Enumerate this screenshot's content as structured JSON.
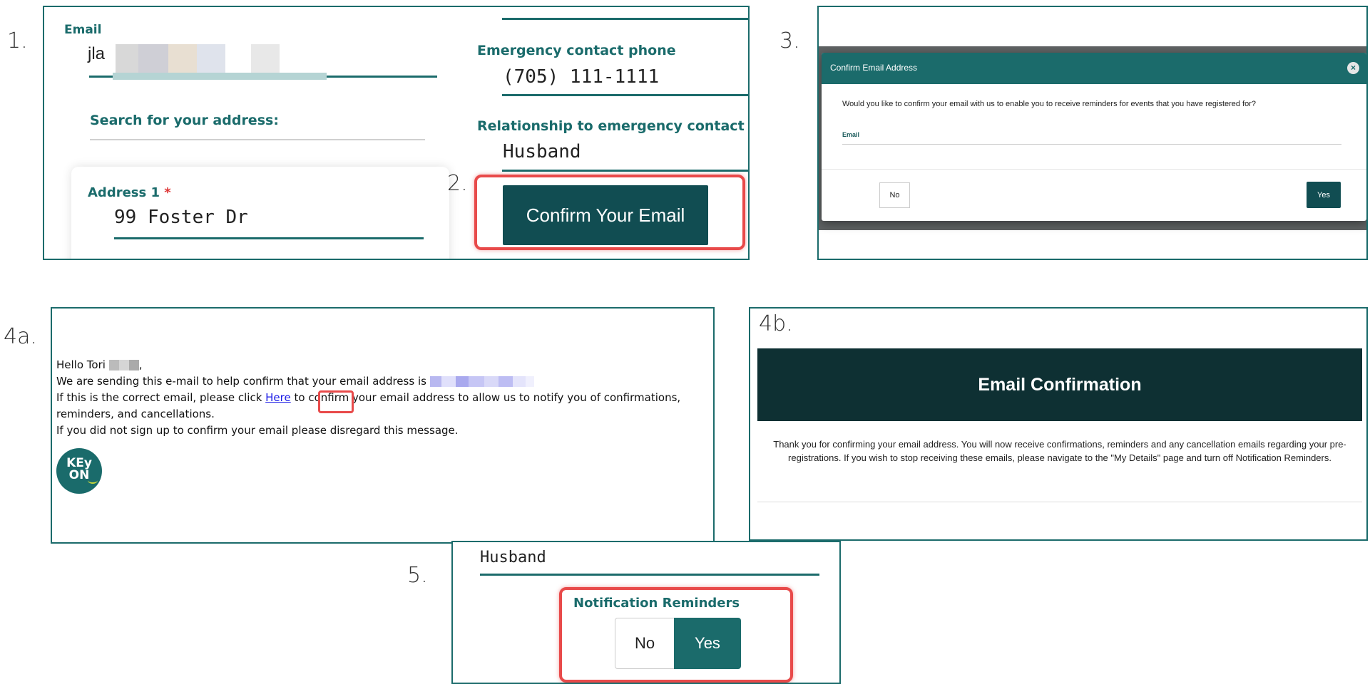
{
  "steps": {
    "s1": "1.",
    "s2": "2.",
    "s3": "3.",
    "s4a": "4a.",
    "s4b": "4b.",
    "s5": "5."
  },
  "panel1": {
    "email_label": "Email",
    "email_value": "jla",
    "search_label": "Search for your address:",
    "address1_label": "Address 1",
    "address1_required": "*",
    "address1_value": "99 Foster Dr",
    "emergency_phone_label": "Emergency contact phone",
    "emergency_phone_value": "(705) 111-1111",
    "relationship_label": "Relationship to emergency contact p",
    "relationship_value": "Husband",
    "confirm_button": "Confirm Your Email"
  },
  "panel3": {
    "modal_title": "Confirm Email Address",
    "close_icon": "close-icon",
    "question": "Would you like to confirm your email with us to enable you to receive reminders for events that you have registered for?",
    "email_label": "Email",
    "no_button": "No",
    "yes_button": "Yes"
  },
  "panel4a": {
    "greeting": "Hello Tori",
    "greeting_end": ",",
    "line1": "We are sending this e-mail to help confirm that your email address is",
    "line2_before": "If this is the correct email, please click ",
    "here_link": "Here",
    "line2_after": " to confirm your email address to allow us to notify you of confirmations,",
    "line3": "reminders, and cancellations.",
    "line4": "If you did not sign up to confirm your email please disregard this message.",
    "logo_top": "KEy",
    "logo_bottom": "ON"
  },
  "panel4b": {
    "title": "Email Confirmation",
    "message": "Thank you for confirming your email address. You will now receive confirmations, reminders and any cancellation emails regarding your pre-registrations. If you wish to stop receiving these emails, please navigate to the \"My Details\" page and turn off Notification Reminders."
  },
  "panel5": {
    "relationship_value": "Husband",
    "notif_label": "Notification Reminders",
    "no_option": "No",
    "yes_option": "Yes",
    "selected": "Yes"
  },
  "colors": {
    "teal": "#1b6b6b",
    "dark_teal": "#114d52",
    "header_dark": "#0e3033",
    "highlight_red": "#e84a4a"
  }
}
